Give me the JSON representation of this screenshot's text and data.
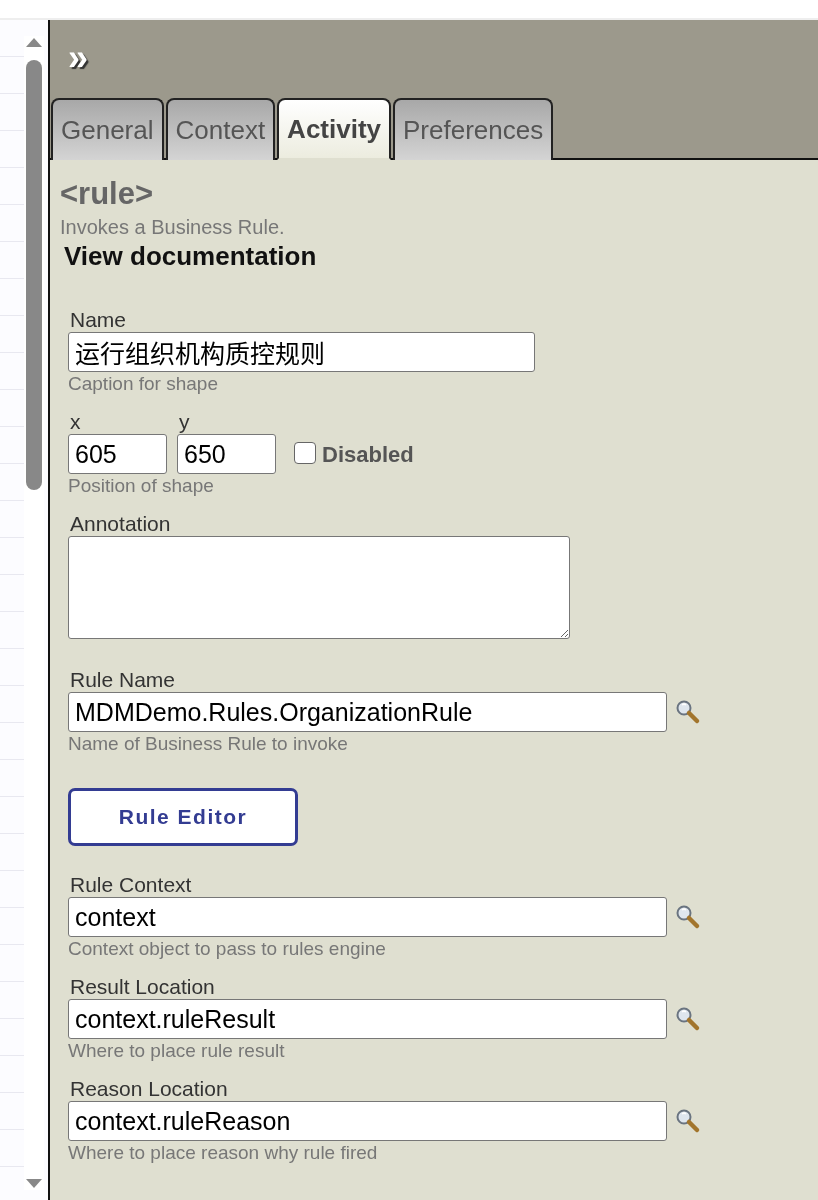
{
  "panel": {
    "collapse_glyph": "»"
  },
  "tabs": [
    {
      "label": "General",
      "selected": false
    },
    {
      "label": "Context",
      "selected": false
    },
    {
      "label": "Activity",
      "selected": true
    },
    {
      "label": "Preferences",
      "selected": false
    }
  ],
  "header": {
    "title": "<rule>",
    "description": "Invokes a Business Rule.",
    "doc_link": "View documentation"
  },
  "fields": [
    {
      "kind": "text",
      "label": "Name",
      "value": "运行组织机构质控规则",
      "hint": "Caption for shape",
      "lookup": false
    },
    {
      "kind": "position",
      "x_label": "x",
      "x_value": "605",
      "y_label": "y",
      "y_value": "650",
      "checkbox_label": "Disabled",
      "checked": false,
      "hint": "Position of shape"
    },
    {
      "kind": "textarea",
      "label": "Annotation"
    },
    {
      "kind": "text",
      "label": "Rule Name",
      "value": "MDMDemo.Rules.OrganizationRule",
      "hint": "Name of Business Rule to invoke",
      "lookup": true
    },
    {
      "kind": "button",
      "label": "Rule Editor"
    },
    {
      "kind": "text",
      "label": "Rule Context",
      "value": "context",
      "hint": "Context object to pass to rules engine",
      "lookup": true
    },
    {
      "kind": "text",
      "label": "Result Location",
      "value": "context.ruleResult",
      "hint": "Where to place rule result",
      "lookup": true
    },
    {
      "kind": "text",
      "label": "Reason Location",
      "value": "context.ruleReason",
      "hint": "Where to place reason why rule fired",
      "lookup": true
    }
  ]
}
